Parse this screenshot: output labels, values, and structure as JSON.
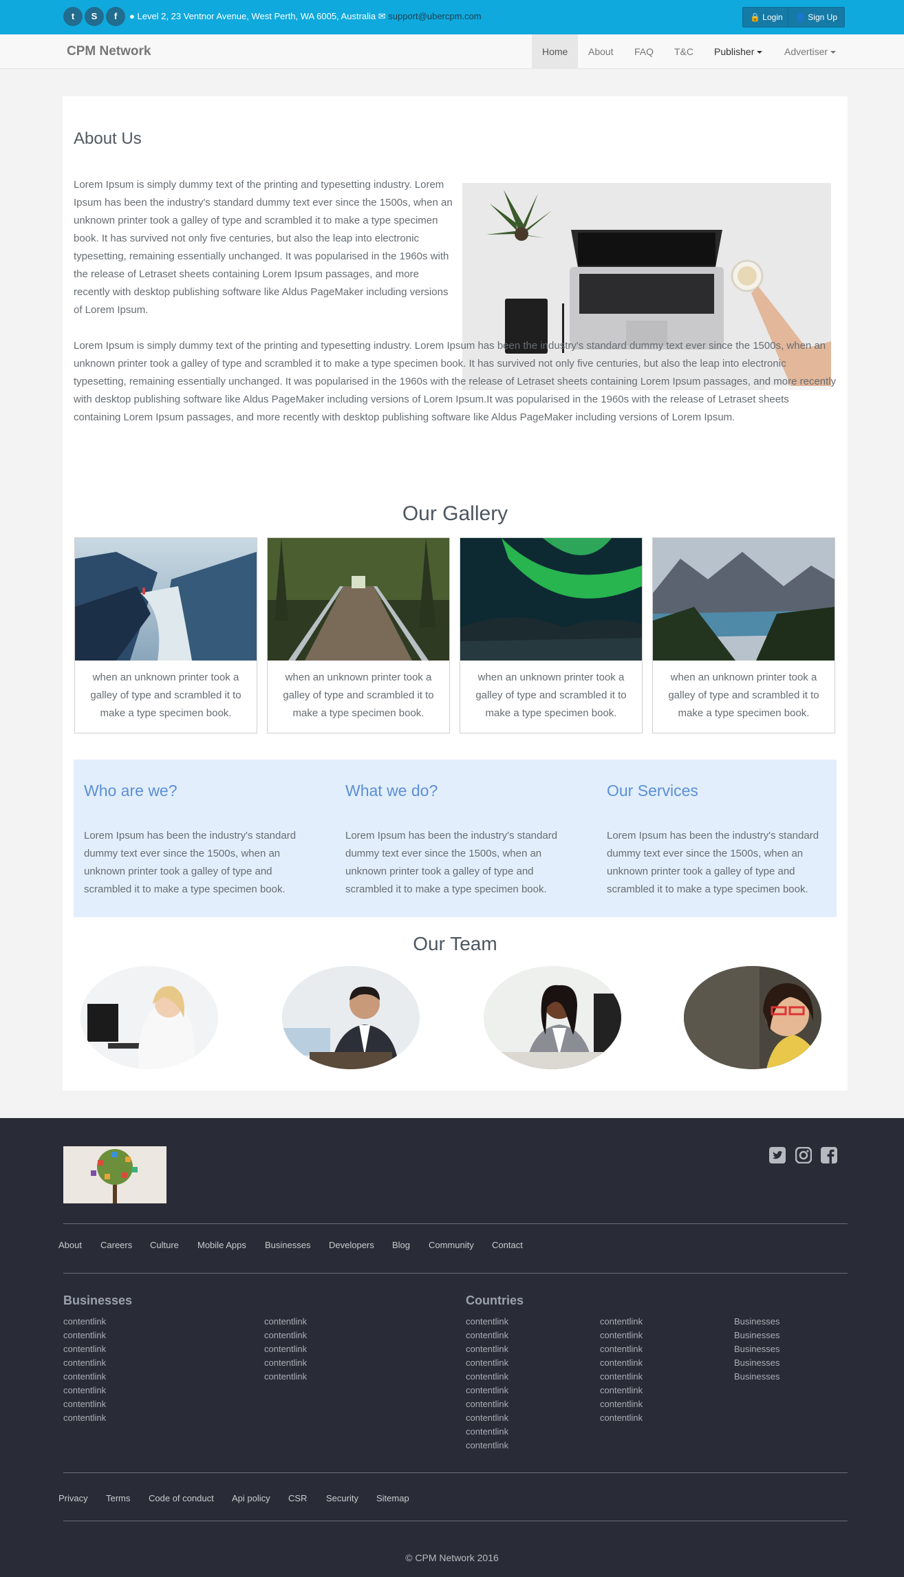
{
  "topbar": {
    "social": [
      {
        "icon": "twitter-icon",
        "glyph": "t"
      },
      {
        "icon": "skype-icon",
        "glyph": "S"
      },
      {
        "icon": "facebook-icon",
        "glyph": "f"
      }
    ],
    "address": "Level 2, 23 Ventnor Avenue, West Perth, WA 6005, Australia",
    "email": "support@ubercpm.com",
    "login_label": "Login",
    "signup_label": "Sign Up"
  },
  "navbar": {
    "brand": "CPM Network",
    "items": [
      {
        "label": "Home",
        "active": true
      },
      {
        "label": "About"
      },
      {
        "label": "FAQ"
      },
      {
        "label": "T&C"
      },
      {
        "label": "Publisher",
        "dropdown": true
      },
      {
        "label": "Advertiser",
        "dropdown": true
      }
    ]
  },
  "about": {
    "title": "About Us",
    "para1": "Lorem Ipsum is simply dummy text of the printing and typesetting industry. Lorem Ipsum has been the industry's standard dummy text ever since the 1500s, when an unknown printer took a galley of type and scrambled it to make a type specimen book. It has survived not only five centuries, but also the leap into electronic typesetting, remaining essentially unchanged. It was popularised in the 1960s with the release of Letraset sheets containing Lorem Ipsum passages, and more recently with desktop publishing software like Aldus PageMaker including versions of Lorem Ipsum.",
    "para2": "Lorem Ipsum is simply dummy text of the printing and typesetting industry. Lorem Ipsum has been the industry's standard dummy text ever since the 1500s, when an unknown printer took a galley of type and scrambled it to make a type specimen book. It has survived not only five centuries, but also the leap into electronic typesetting, remaining essentially unchanged. It was popularised in the 1960s with the release of Letraset sheets containing Lorem Ipsum passages, and more recently with desktop publishing software like Aldus PageMaker including versions of Lorem Ipsum.It was popularised in the 1960s with the release of Letraset sheets containing Lorem Ipsum passages, and more recently with desktop publishing software like Aldus PageMaker including versions of Lorem Ipsum."
  },
  "gallery": {
    "title": "Our Gallery",
    "items": [
      {
        "caption": "when an unknown printer took a galley of type and scrambled it to make a type specimen book."
      },
      {
        "caption": "when an unknown printer took a galley of type and scrambled it to make a type specimen book."
      },
      {
        "caption": "when an unknown printer took a galley of type and scrambled it to make a type specimen book."
      },
      {
        "caption": "when an unknown printer took a galley of type and scrambled it to make a type specimen book."
      }
    ]
  },
  "info": [
    {
      "title": "Who are we?",
      "text": "Lorem Ipsum has been the industry's standard dummy text ever since the 1500s, when an unknown printer took a galley of type and scrambled it to make a type specimen book."
    },
    {
      "title": "What we do?",
      "text": "Lorem Ipsum has been the industry's standard dummy text ever since the 1500s, when an unknown printer took a galley of type and scrambled it to make a type specimen book."
    },
    {
      "title": "Our Services",
      "text": "Lorem Ipsum has been the industry's standard dummy text ever since the 1500s, when an unknown printer took a galley of type and scrambled it to make a type specimen book."
    }
  ],
  "team": {
    "title": "Our Team"
  },
  "footer": {
    "social_icons": [
      "twitter-icon",
      "instagram-icon",
      "facebook-icon"
    ],
    "links": [
      "About",
      "Careers",
      "Culture",
      "Mobile Apps",
      "Businesses",
      "Developers",
      "Blog",
      "Community",
      "Contact"
    ],
    "businesses_title": "Businesses",
    "businesses_col1": [
      "contentlink",
      "contentlink",
      "contentlink",
      "contentlink",
      "contentlink",
      "contentlink",
      "contentlink",
      "contentlink"
    ],
    "businesses_col2": [
      "contentlink",
      "contentlink",
      "contentlink",
      "contentlink",
      "contentlink"
    ],
    "countries_title": "Countries",
    "countries_col1": [
      "contentlink",
      "contentlink",
      "contentlink",
      "contentlink",
      "contentlink",
      "contentlink",
      "contentlink",
      "contentlink",
      "contentlink",
      "contentlink"
    ],
    "countries_col2": [
      "contentlink",
      "contentlink",
      "contentlink",
      "contentlink",
      "contentlink",
      "contentlink",
      "contentlink",
      "contentlink"
    ],
    "countries_col3": [
      "Businesses",
      "Businesses",
      "Businesses",
      "Businesses",
      "Businesses"
    ],
    "bottom_links": [
      "Privacy",
      "Terms",
      "Code of conduct",
      "Api policy",
      "CSR",
      "Security",
      "Sitemap"
    ],
    "copyright": "© CPM Network 2016"
  },
  "colors": {
    "topbar": "#0fa9dd",
    "footer": "#292c36",
    "accent_heading": "#5b8fd6",
    "info_bg": "#e2eefc"
  }
}
